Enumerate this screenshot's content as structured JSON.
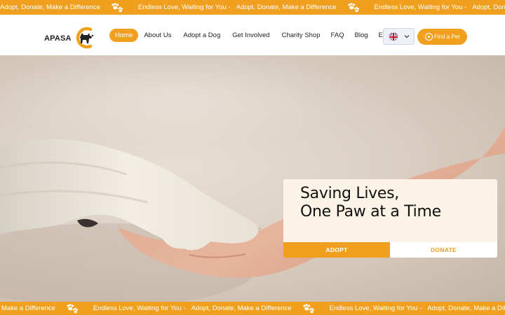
{
  "ticker": {
    "top": [
      "Adopt, Donate, Make a Difference",
      "Endless Love, Waiting for You -",
      "Adopt, Donate, Make a Difference",
      "Endless Love, Waiting for You -",
      "Adopt, Donate, Make a Difference"
    ],
    "bottom": [
      "Make a Difference",
      "Endless Love, Waiting for You -",
      "Adopt, Donate, Make a Difference",
      "Endless Love, Waiting for You -",
      "Adopt, Donate, Make a Difference"
    ]
  },
  "header": {
    "logo_text": "APASA",
    "nav": [
      {
        "label": "Home",
        "active": true
      },
      {
        "label": "About Us"
      },
      {
        "label": "Adopt a Dog"
      },
      {
        "label": "Get Involved"
      },
      {
        "label": "Charity Shop"
      },
      {
        "label": "FAQ"
      },
      {
        "label": "Blog"
      },
      {
        "label": "Events"
      }
    ],
    "language_icon": "uk-flag-icon",
    "find_pet_label": "Find a Pet"
  },
  "hero": {
    "title_line1": "Saving Lives,",
    "title_line2": "One Paw at a Time",
    "adopt_label": "ADOPT",
    "donate_label": "DONATE"
  },
  "colors": {
    "accent": "#f0a01e",
    "card_bg": "#faf3e6"
  }
}
